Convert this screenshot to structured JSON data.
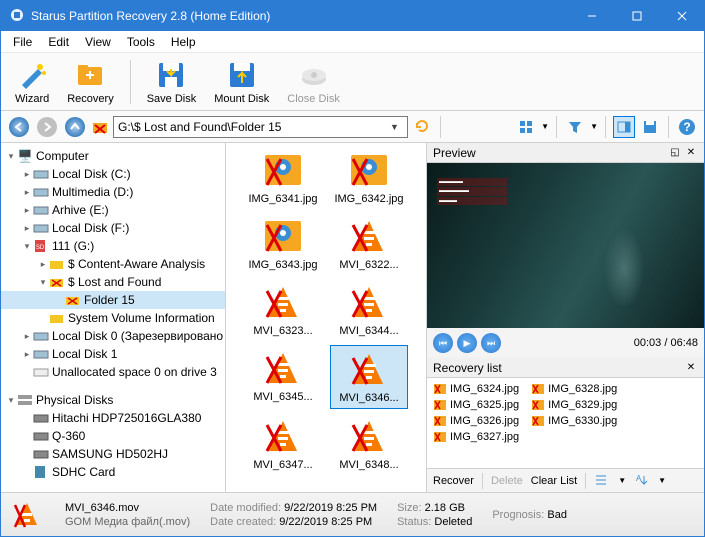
{
  "window": {
    "title": "Starus Partition Recovery 2.8 (Home Edition)"
  },
  "menubar": [
    "File",
    "Edit",
    "View",
    "Tools",
    "Help"
  ],
  "toolbar": {
    "wizard": "Wizard",
    "recovery": "Recovery",
    "savedisk": "Save Disk",
    "mountdisk": "Mount Disk",
    "closedisk": "Close Disk"
  },
  "address": {
    "path": "G:\\$ Lost and Found\\Folder 15"
  },
  "tree": {
    "root1": "Computer",
    "localC": "Local Disk (C:)",
    "multiD": "Multimedia (D:)",
    "arhiveE": "Arhive (E:)",
    "localF": "Local Disk (F:)",
    "g111": "111 (G:)",
    "content": "$ Content-Aware Analysis",
    "lost": "$ Lost and Found",
    "folder15": "Folder 15",
    "sysvol": "System Volume Information",
    "local0": "Local Disk 0 (Зарезервировано",
    "local1": "Local Disk 1",
    "unalloc": "Unallocated space 0 on drive 3",
    "root2": "Physical Disks",
    "hitachi": "Hitachi HDP725016GLA380",
    "q360": "Q-360",
    "samsung": "SAMSUNG HD502HJ",
    "sdhc": "SDHC Card"
  },
  "thumbs": [
    [
      "IMG_6341.jpg",
      "IMG_6342.jpg"
    ],
    [
      "IMG_6343.jpg",
      "MVI_6322..."
    ],
    [
      "MVI_6323...",
      "MVI_6344..."
    ],
    [
      "MVI_6345...",
      "MVI_6346..."
    ],
    [
      "MVI_6347...",
      "MVI_6348..."
    ]
  ],
  "thumbs_selected": "MVI_6346...",
  "preview": {
    "title": "Preview",
    "time": "00:03 / 06:48"
  },
  "recovery_list": {
    "title": "Recovery list",
    "col1": [
      "IMG_6324.jpg",
      "IMG_6325.jpg",
      "IMG_6326.jpg",
      "IMG_6327.jpg"
    ],
    "col2": [
      "IMG_6328.jpg",
      "IMG_6329.jpg",
      "IMG_6330.jpg"
    ],
    "recover": "Recover",
    "delete": "Delete",
    "clear": "Clear List"
  },
  "status": {
    "filename": "MVI_6346.mov",
    "filetype": "GOM Медиа файл(.mov)",
    "mod_label": "Date modified:",
    "mod_val": "9/22/2019 8:25 PM",
    "created_label": "Date created:",
    "created_val": "9/22/2019 8:25 PM",
    "size_label": "Size:",
    "size_val": "2.18 GB",
    "status_label": "Status:",
    "status_val": "Deleted",
    "prog_label": "Prognosis:",
    "prog_val": "Bad"
  }
}
